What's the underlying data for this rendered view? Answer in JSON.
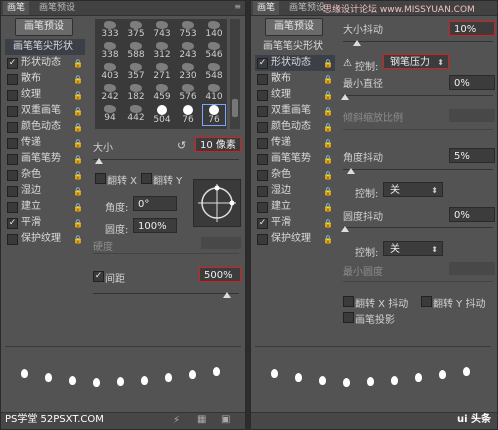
{
  "left_panel": {
    "tabs": [
      "画笔",
      "画笔预设"
    ],
    "preset_button": "画笔预设",
    "list": [
      {
        "label": "画笔笔尖形状",
        "checked": null,
        "locked": false,
        "selected": true
      },
      {
        "label": "形状动态",
        "checked": true,
        "locked": true,
        "selected": false
      },
      {
        "label": "散布",
        "checked": false,
        "locked": true,
        "selected": false
      },
      {
        "label": "纹理",
        "checked": false,
        "locked": true,
        "selected": false
      },
      {
        "label": "双重画笔",
        "checked": false,
        "locked": true,
        "selected": false
      },
      {
        "label": "颜色动态",
        "checked": false,
        "locked": true,
        "selected": false
      },
      {
        "label": "传递",
        "checked": false,
        "locked": true,
        "selected": false
      },
      {
        "label": "画笔笔势",
        "checked": false,
        "locked": true,
        "selected": false
      },
      {
        "label": "杂色",
        "checked": false,
        "locked": true,
        "selected": false
      },
      {
        "label": "湿边",
        "checked": false,
        "locked": true,
        "selected": false
      },
      {
        "label": "建立",
        "checked": false,
        "locked": true,
        "selected": false
      },
      {
        "label": "平滑",
        "checked": true,
        "locked": true,
        "selected": false
      },
      {
        "label": "保护纹理",
        "checked": false,
        "locked": true,
        "selected": false
      }
    ],
    "brush_tips": [
      "333",
      "375",
      "743",
      "753",
      "140",
      "",
      "",
      "",
      "",
      "",
      "338",
      "588",
      "312",
      "243",
      "546",
      "",
      "",
      "",
      "",
      "",
      "403",
      "357",
      "271",
      "230",
      "548",
      "",
      "",
      "",
      "",
      "",
      "242",
      "182",
      "459",
      "576",
      "410",
      "94",
      "442",
      "504",
      "76",
      "76"
    ],
    "size_label": "大小",
    "size_value": "10 像素",
    "flip_x": "翻转 X",
    "flip_y": "翻转 Y",
    "angle_label": "角度:",
    "angle_value": "0°",
    "roundness_label": "圆度:",
    "roundness_value": "100%",
    "hardness_label": "硬度",
    "spacing_label": "间距",
    "spacing_checked": true,
    "spacing_value": "500%"
  },
  "right_panel": {
    "tabs": [
      "画笔",
      "画笔预设"
    ],
    "preset_button": "画笔预设",
    "site_watermark": "思缘设计论坛 www.MISSYUAN.COM",
    "list": [
      {
        "label": "画笔笔尖形状",
        "checked": null,
        "locked": false,
        "selected": false
      },
      {
        "label": "形状动态",
        "checked": true,
        "locked": true,
        "selected": true
      },
      {
        "label": "散布",
        "checked": false,
        "locked": true,
        "selected": false
      },
      {
        "label": "纹理",
        "checked": false,
        "locked": true,
        "selected": false
      },
      {
        "label": "双重画笔",
        "checked": false,
        "locked": true,
        "selected": false
      },
      {
        "label": "颜色动态",
        "checked": false,
        "locked": true,
        "selected": false
      },
      {
        "label": "传递",
        "checked": false,
        "locked": true,
        "selected": false
      },
      {
        "label": "画笔笔势",
        "checked": false,
        "locked": true,
        "selected": false
      },
      {
        "label": "杂色",
        "checked": false,
        "locked": true,
        "selected": false
      },
      {
        "label": "湿边",
        "checked": false,
        "locked": true,
        "selected": false
      },
      {
        "label": "建立",
        "checked": false,
        "locked": true,
        "selected": false
      },
      {
        "label": "平滑",
        "checked": true,
        "locked": true,
        "selected": false
      },
      {
        "label": "保护纹理",
        "checked": false,
        "locked": true,
        "selected": false
      }
    ],
    "size_jitter_label": "大小抖动",
    "size_jitter_value": "10%",
    "control_label": "控制:",
    "control_value": "钢笔压力",
    "min_diameter_label": "最小直径",
    "min_diameter_value": "0%",
    "tilt_scale_label": "倾斜缩放比例",
    "angle_jitter_label": "角度抖动",
    "angle_jitter_value": "5%",
    "angle_control_label": "控制:",
    "angle_control_value": "关",
    "roundness_jitter_label": "圆度抖动",
    "roundness_jitter_value": "0%",
    "roundness_control_label": "控制:",
    "roundness_control_value": "关",
    "min_roundness_label": "最小圆度",
    "flip_x_jitter": "翻转 X 抖动",
    "flip_y_jitter": "翻转 Y 抖动",
    "brush_projection": "画笔投影"
  },
  "watermarks": {
    "bottom_left": "PS学堂 52PSXT.COM",
    "bottom_right": "ui 头条"
  }
}
